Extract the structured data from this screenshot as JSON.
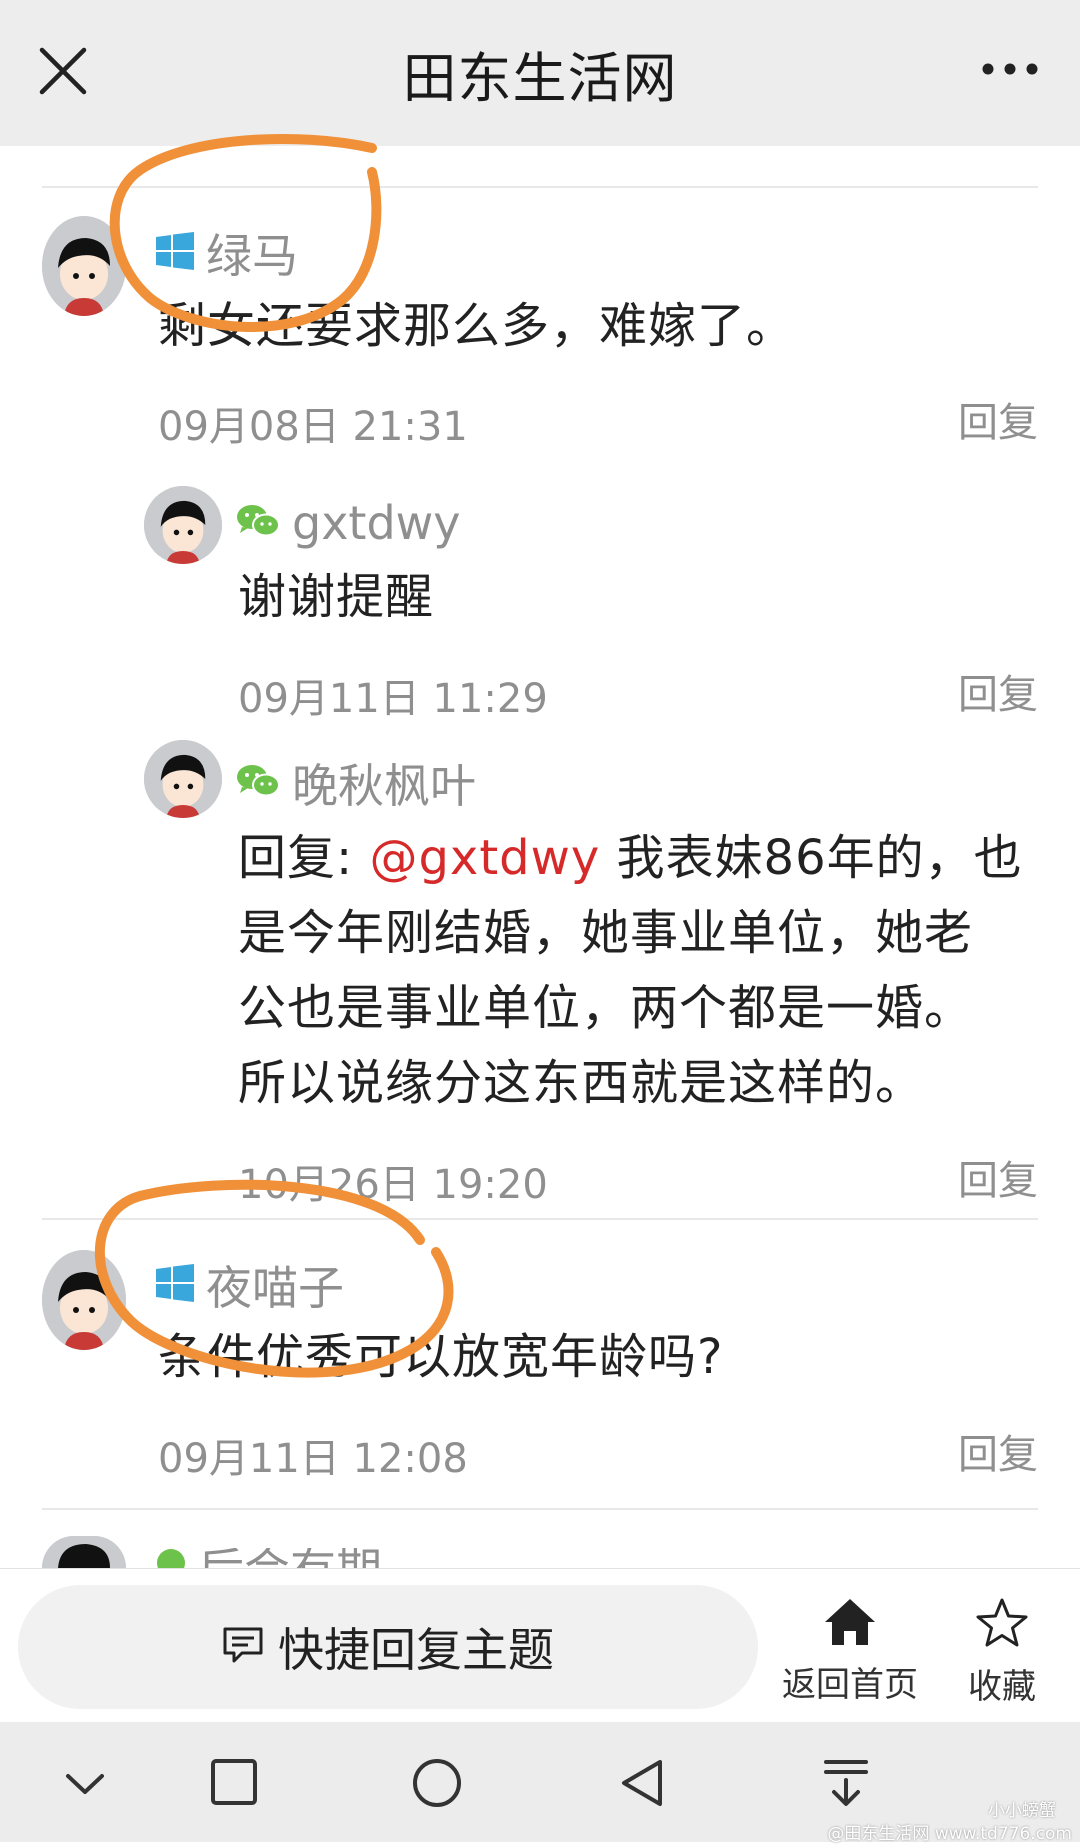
{
  "header": {
    "title": "田东生活网"
  },
  "comments": [
    {
      "username": "绿马",
      "platform_icon": "windows-icon",
      "text": "剩女还要求那么多，难嫁了。",
      "timestamp": "09月08日 21:31",
      "reply_label": "回复"
    },
    {
      "username": "gxtdwy",
      "platform_icon": "wechat-icon",
      "text": "谢谢提醒",
      "timestamp": "09月11日 11:29",
      "reply_label": "回复"
    },
    {
      "username": "晚秋枫叶",
      "platform_icon": "wechat-icon",
      "reply_prefix": "回复: ",
      "mention": "@gxtdwy",
      "text_lines": [
        " 我表妹86年的，也",
        "是今年刚结婚，她事业单位，她老",
        "公也是事业单位，两个都是一婚。",
        "所以说缘分这东西就是这样的。"
      ],
      "timestamp": "10月26日 19:20",
      "reply_label": "回复"
    },
    {
      "username": "夜喵子",
      "platform_icon": "windows-icon",
      "text": "条件优秀可以放宽年龄吗?",
      "timestamp": "09月11日 12:08",
      "reply_label": "回复"
    },
    {
      "username": "后会有期",
      "platform_icon": "wechat-icon"
    }
  ],
  "actionbar": {
    "quick_reply_label": "快捷回复主题",
    "home_label": "返回首页",
    "favorite_label": "收藏"
  },
  "watermark": {
    "line1": "小小螃蟹",
    "line2": "@田东生活网 www.td776.com"
  },
  "colors": {
    "windows_icon": "#3aa7dc",
    "wechat_icon": "#6cc24a",
    "mention": "#d62a2a",
    "annotation": "#f0913a"
  }
}
